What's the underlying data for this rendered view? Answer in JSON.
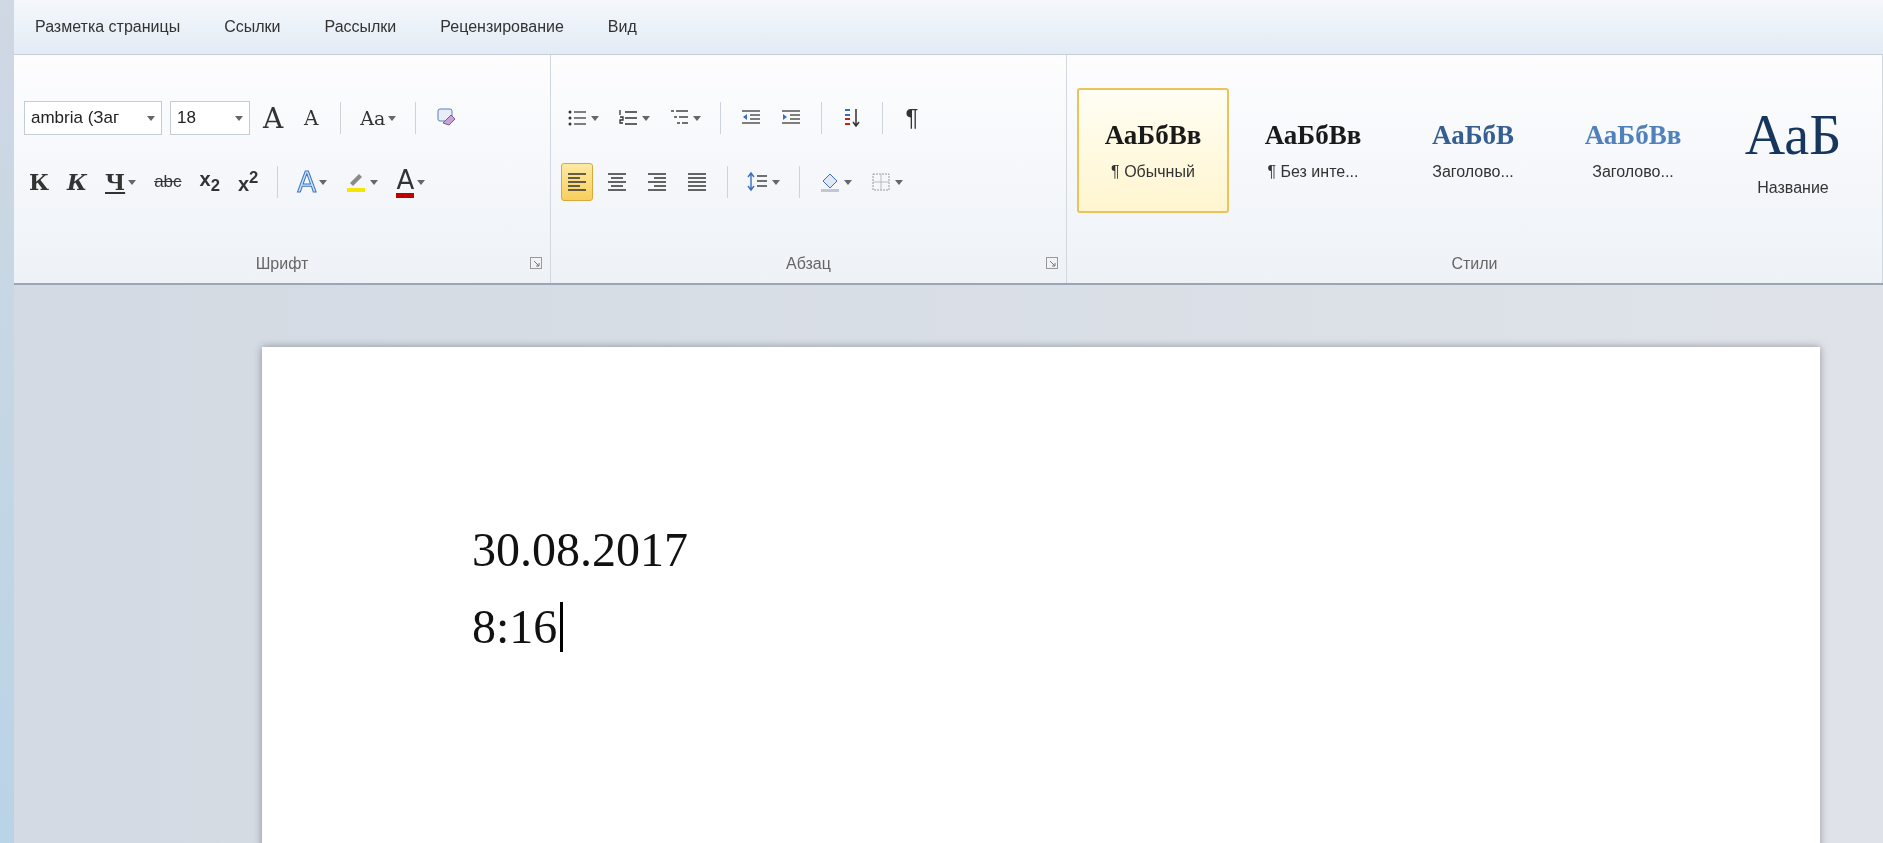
{
  "tabs": [
    {
      "label": "Разметка страницы",
      "selected": false
    },
    {
      "label": "Ссылки",
      "selected": false
    },
    {
      "label": "Рассылки",
      "selected": false
    },
    {
      "label": "Рецензирование",
      "selected": false
    },
    {
      "label": "Вид",
      "selected": false
    }
  ],
  "font_group": {
    "label": "Шрифт",
    "font_name": "ambria (Заг",
    "font_size": "18",
    "row1": [
      {
        "kind": "grow",
        "text": "A"
      },
      {
        "kind": "shrink",
        "text": "A"
      },
      {
        "kind": "sep"
      },
      {
        "kind": "change-case",
        "text": "Aa",
        "dropdown": true
      },
      {
        "kind": "sep"
      },
      {
        "kind": "clear-format"
      }
    ],
    "row2": [
      {
        "kind": "bold",
        "text": "К"
      },
      {
        "kind": "italic",
        "text": "К"
      },
      {
        "kind": "underline",
        "text": "Ч",
        "dropdown": true
      },
      {
        "kind": "strike",
        "text": "abc"
      },
      {
        "kind": "subscript",
        "text": "x$_{2}$"
      },
      {
        "kind": "superscript",
        "text": "x$^{2}$"
      },
      {
        "kind": "sep"
      },
      {
        "kind": "text-effects",
        "text": "A",
        "dropdown": true
      },
      {
        "kind": "highlight",
        "dropdown": true
      },
      {
        "kind": "font-color",
        "text": "A",
        "dropdown": true
      }
    ]
  },
  "paragraph_group": {
    "label": "Абзац",
    "row1": [
      {
        "kind": "bullets",
        "dropdown": true
      },
      {
        "kind": "numbering",
        "dropdown": true
      },
      {
        "kind": "multilevel",
        "dropdown": true
      },
      {
        "kind": "sep"
      },
      {
        "kind": "indent-decrease"
      },
      {
        "kind": "indent-increase"
      },
      {
        "kind": "sep"
      },
      {
        "kind": "sort"
      },
      {
        "kind": "sep"
      },
      {
        "kind": "pilcrow",
        "text": "¶"
      }
    ],
    "row2": [
      {
        "kind": "align-left",
        "selected": true
      },
      {
        "kind": "align-center",
        "selected": false
      },
      {
        "kind": "align-right",
        "selected": false
      },
      {
        "kind": "justify",
        "selected": false
      },
      {
        "kind": "sep"
      },
      {
        "kind": "line-spacing",
        "dropdown": true
      },
      {
        "kind": "sep"
      },
      {
        "kind": "shading",
        "dropdown": true
      },
      {
        "kind": "borders",
        "dropdown": true
      }
    ]
  },
  "styles_group": {
    "label": "Стили",
    "items": [
      {
        "sample": "АаБбВв",
        "name": "¶ Обычный",
        "color": "#1a1a1a",
        "selected": true
      },
      {
        "sample": "АаБбВв",
        "name": "¶ Без инте...",
        "color": "#1a1a1a",
        "selected": false
      },
      {
        "sample": "АаБбВ",
        "name": "Заголово...",
        "color": "#365f91",
        "selected": false
      },
      {
        "sample": "АаБбВв",
        "name": "Заголово...",
        "color": "#4f81bd",
        "selected": false
      },
      {
        "sample": "АаБ",
        "name": "Название",
        "color": "#17365d",
        "selected": false
      }
    ]
  },
  "document": {
    "lines": [
      "30.08.2017",
      "8:16"
    ]
  }
}
